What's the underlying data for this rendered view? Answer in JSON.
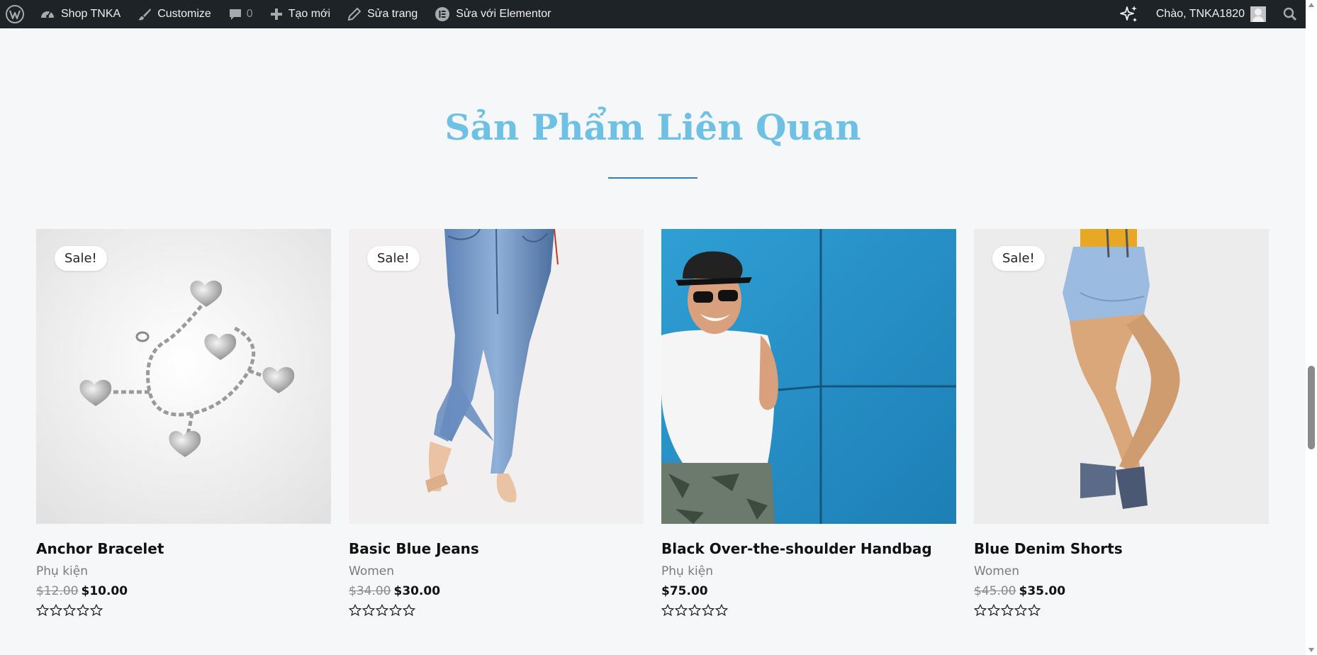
{
  "admin_bar": {
    "site_name": "Shop TNKA",
    "customize": "Customize",
    "comments_count": "0",
    "new_label": "Tạo mới",
    "edit_page": "Sửa trang",
    "edit_elementor": "Sửa với Elementor",
    "greeting": "Chào, TNKA1820",
    "icons": [
      "wordpress-icon",
      "dashboard-icon",
      "brush-icon",
      "comment-icon",
      "plus-icon",
      "pencil-icon",
      "elementor-icon",
      "sparkle-icon",
      "search-icon"
    ]
  },
  "section": {
    "title": "Sản Phẩm Liên Quan",
    "title_color": "#6ec1e4",
    "divider_color": "#2d7fbf"
  },
  "products": [
    {
      "name": "Anchor Bracelet",
      "category": "Phụ kiện",
      "old_price": "$12.00",
      "price": "$10.00",
      "sale_badge": "Sale!",
      "rating": 0
    },
    {
      "name": "Basic Blue Jeans",
      "category": "Women",
      "old_price": "$34.00",
      "price": "$30.00",
      "sale_badge": "Sale!",
      "rating": 0
    },
    {
      "name": "Black Over-the-shoulder Handbag",
      "category": "Phụ kiện",
      "old_price": "",
      "price": "$75.00",
      "sale_badge": "",
      "rating": 0
    },
    {
      "name": "Blue Denim Shorts",
      "category": "Women",
      "old_price": "$45.00",
      "price": "$35.00",
      "sale_badge": "Sale!",
      "rating": 0
    }
  ]
}
